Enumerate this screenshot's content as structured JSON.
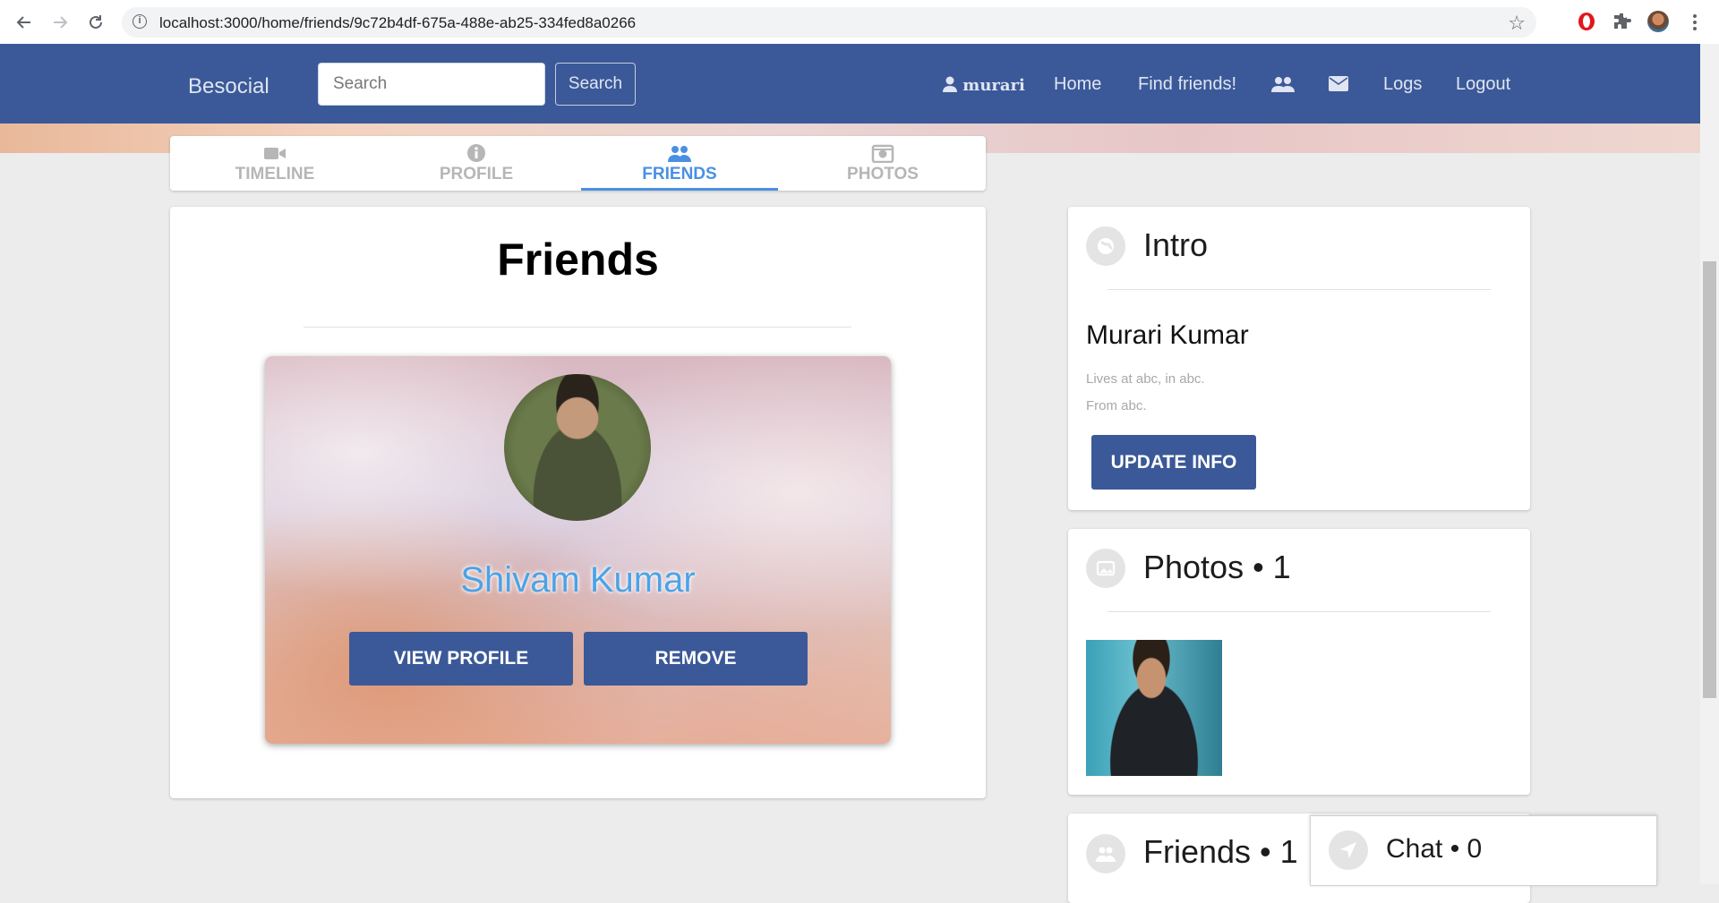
{
  "browser": {
    "url": "localhost:3000/home/friends/9c72b4df-675a-488e-ab25-334fed8a0266"
  },
  "nav": {
    "brand": "Besocial",
    "search_placeholder": "Search",
    "search_button": "Search",
    "user": "murari",
    "home": "Home",
    "find_friends": "Find friends!",
    "logs": "Logs",
    "logout": "Logout"
  },
  "tabs": [
    {
      "label": "TIMELINE",
      "icon": "video-icon",
      "active": false
    },
    {
      "label": "PROFILE",
      "icon": "info-icon",
      "active": false
    },
    {
      "label": "FRIENDS",
      "icon": "users-icon",
      "active": true
    },
    {
      "label": "PHOTOS",
      "icon": "camera-icon",
      "active": false
    }
  ],
  "friends": {
    "title": "Friends",
    "cards": [
      {
        "name": "Shivam Kumar",
        "view_label": "VIEW PROFILE",
        "remove_label": "REMOVE"
      }
    ]
  },
  "intro": {
    "title": "Intro",
    "name": "Murari Kumar",
    "lives": "Lives at abc, in abc.",
    "from": "From abc.",
    "update_button": "UPDATE INFO"
  },
  "photos": {
    "title": "Photos • 1"
  },
  "friends_sidebar": {
    "title": "Friends • 1"
  },
  "chat": {
    "label": "Chat • 0"
  },
  "colors": {
    "brand_blue": "#3b5998",
    "accent_blue": "#4a90e2",
    "background": "#ececec"
  }
}
